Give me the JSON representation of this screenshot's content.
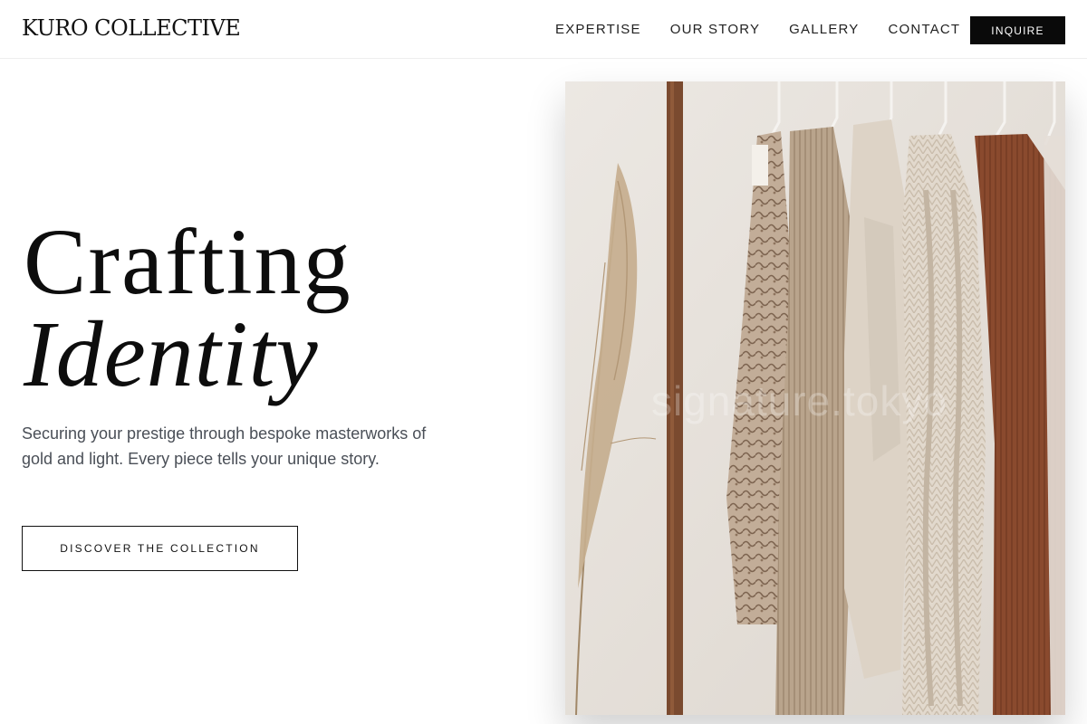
{
  "header": {
    "brand": "KURO COLLECTIVE",
    "nav": [
      {
        "label": "EXPERTISE"
      },
      {
        "label": "OUR STORY"
      },
      {
        "label": "GALLERY"
      },
      {
        "label": "CONTACT"
      }
    ],
    "cta_label": "INQUIRE"
  },
  "hero": {
    "title_line1": "Crafting",
    "title_line2": "Identity",
    "description": "Securing your prestige through bespoke masterworks of gold and light. Every piece tells your unique story.",
    "button_label": "DISCOVER THE COLLECTION"
  },
  "image": {
    "watermark": "signature.tokyo",
    "colors": {
      "background": "#e7e2dc",
      "rod": "#7a4a2f",
      "brown_sweater": "#8a4a2e",
      "cream_knit": "#ddd3c6",
      "beige_knit": "#b9a48c",
      "snake_print": "#b7a08a",
      "pampas": "#c6ae8e"
    }
  },
  "colors": {
    "accent_dark": "#0a0a0a",
    "body_text": "#4a4f57"
  }
}
